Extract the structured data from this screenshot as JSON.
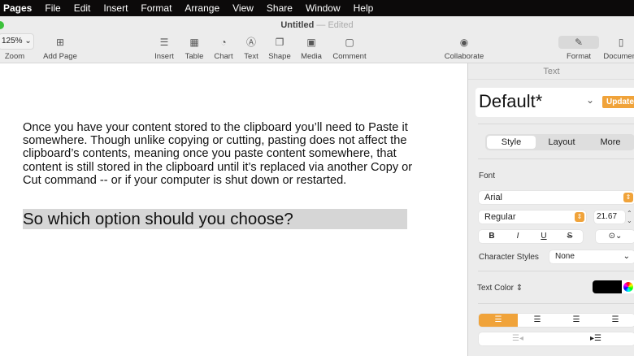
{
  "menubar": {
    "app": "Pages",
    "items": [
      "File",
      "Edit",
      "Insert",
      "Format",
      "Arrange",
      "View",
      "Share",
      "Window",
      "Help"
    ]
  },
  "window": {
    "title": "Untitled",
    "separator": "—",
    "status": "Edited"
  },
  "toolbar": {
    "zoom_value": "125%",
    "zoom": "Zoom",
    "add_page": "Add Page",
    "insert": "Insert",
    "table": "Table",
    "chart": "Chart",
    "text": "Text",
    "shape": "Shape",
    "media": "Media",
    "comment": "Comment",
    "collaborate": "Collaborate",
    "format": "Format",
    "document": "Document"
  },
  "document": {
    "paragraph": "Once you have your content stored to the clipboard you’ll need to Paste it somewhere. Though unlike copying or cutting, pasting does not affect the clipboard’s contents, meaning once you paste content somewhere, that content is still stored in the clipboard until it’s replaced via another Copy or Cut command -- or if your computer is shut down or restarted.",
    "heading": "So which option should you choose?"
  },
  "sidebar": {
    "header": "Text",
    "style_name": "Default*",
    "update": "Update",
    "tabs": [
      "Style",
      "Layout",
      "More"
    ],
    "font_label": "Font",
    "font": "Arial",
    "typeface": "Regular",
    "size": "21.67 pt",
    "bold": "B",
    "italic": "I",
    "underline": "U",
    "strike": "S",
    "char_styles_label": "Character Styles",
    "char_styles": "None",
    "text_color_label": "Text Color",
    "text_color": "#000000",
    "accent": "#f0a33a"
  }
}
